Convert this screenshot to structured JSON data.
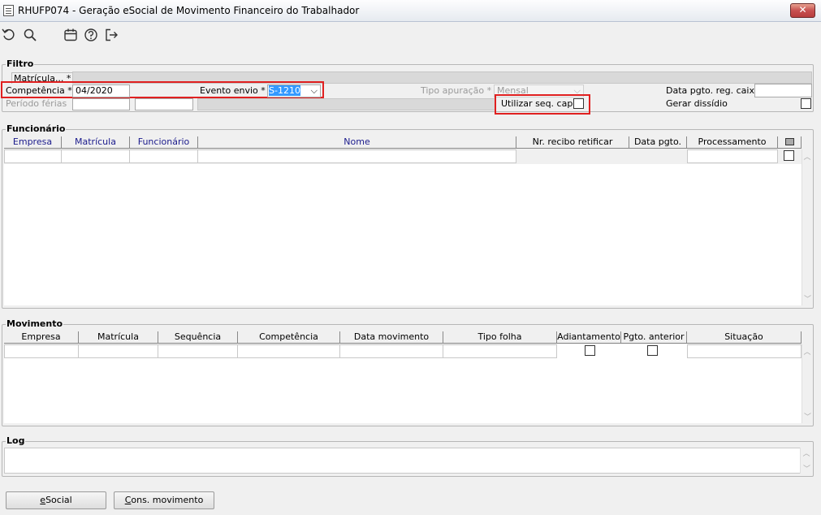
{
  "window": {
    "title": "RHUFP074 - Geração eSocial de Movimento Financeiro do Trabalhador",
    "close_label": "✕"
  },
  "toolbar": {
    "icons": [
      "undo-icon",
      "search-icon",
      "calendar-icon",
      "help-icon",
      "exit-icon"
    ]
  },
  "filtro": {
    "label": "Filtro",
    "matricula_label": "Matrícula... *",
    "competencia_label": "Competência *",
    "competencia_value": "04/2020",
    "evento_label": "Evento envio *",
    "evento_value": "S-1210",
    "tipo_apuracao_label": "Tipo apuração *",
    "tipo_apuracao_value": "Mensal",
    "data_pgto_label": "Data pgto. reg. caixa",
    "periodo_ferias_label": "Período férias",
    "utilizar_seq_label": "Utilizar seq. capa",
    "gerar_dissidio_label": "Gerar dissídio"
  },
  "funcionario": {
    "label": "Funcionário",
    "columns": [
      "Empresa",
      "Matrícula",
      "Funcionário",
      "Nome",
      "Nr. recibo retificar",
      "Data pgto.",
      "Processamento"
    ]
  },
  "movimento": {
    "label": "Movimento",
    "columns": [
      "Empresa",
      "Matrícula",
      "Sequência",
      "Competência",
      "Data movimento",
      "Tipo folha",
      "Adiantamento",
      "Pgto. anterior",
      "Situação"
    ]
  },
  "log": {
    "label": "Log"
  },
  "buttons": {
    "esocial_first": "e",
    "esocial_rest": "Social",
    "cons_first": "C",
    "cons_rest": "ons. movimento"
  },
  "colors": {
    "highlight": "#e02020",
    "selection": "#3399ff"
  }
}
